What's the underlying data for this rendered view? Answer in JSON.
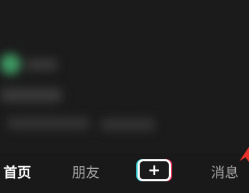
{
  "tabs": [
    {
      "id": "home",
      "label": "首页",
      "active": true
    },
    {
      "id": "friends",
      "label": "朋友",
      "active": false
    },
    {
      "id": "messages",
      "label": "消息",
      "active": false
    }
  ],
  "create_button": {
    "label": "+",
    "icon": "plus-icon"
  },
  "colors": {
    "background": "#1b1b1b",
    "nav_background": "#191919",
    "active_tab_text": "#ffffff",
    "inactive_tab_text": "#a6a6a6",
    "plus_accent_cyan": "#38d6df",
    "plus_accent_red": "#f0355e",
    "annotation_arrow": "#e8312a"
  },
  "annotation": {
    "icon": "red-arrow-icon"
  }
}
